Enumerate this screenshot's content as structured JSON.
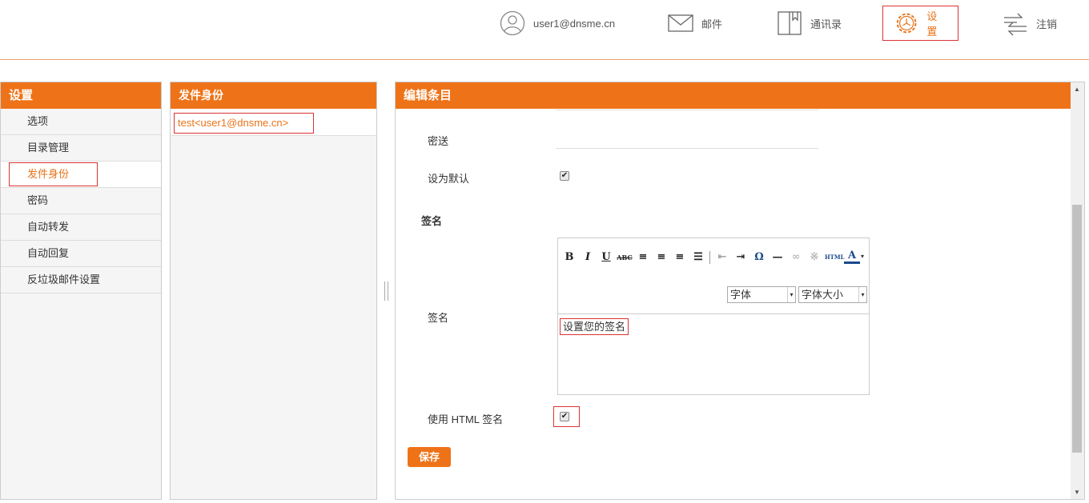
{
  "header": {
    "user": "user1@dnsme.cn",
    "mail": "邮件",
    "contacts": "通讯录",
    "settings": "设置",
    "logout": "注销"
  },
  "settings_panel": {
    "title": "设置",
    "items": [
      "选项",
      "目录管理",
      "发件身份",
      "密码",
      "自动转发",
      "自动回复",
      "反垃圾邮件设置"
    ]
  },
  "identity_panel": {
    "title": "发件身份",
    "entry": "test<user1@dnsme.cn>"
  },
  "edit_panel": {
    "title": "编辑条目",
    "bcc_label": "密送",
    "default_label": "设为默认",
    "signature_section": "签名",
    "signature_label": "签名",
    "font_select": "字体",
    "font_size_select": "字体大小",
    "signature_text": "设置您的签名",
    "html_signature_label": "使用 HTML 签名",
    "save": "保存"
  },
  "accent_color": "#ee7318",
  "highlight_color": "#dd3333"
}
